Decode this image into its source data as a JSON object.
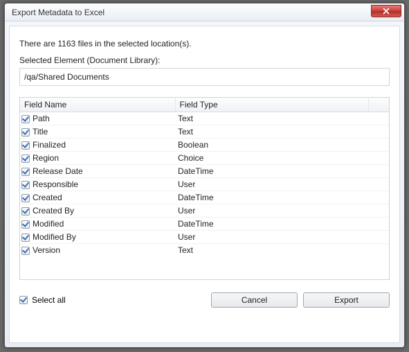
{
  "window": {
    "title": "Export Metadata to Excel"
  },
  "info": {
    "file_count_line": "There are 1163 files in the selected location(s)."
  },
  "selected_element": {
    "label": "Selected Element (Document Library):",
    "path": "/qa/Shared Documents"
  },
  "table": {
    "headers": {
      "name": "Field Name",
      "type": "Field Type"
    },
    "rows": [
      {
        "checked": true,
        "name": "Path",
        "type": "Text"
      },
      {
        "checked": true,
        "name": "Title",
        "type": "Text"
      },
      {
        "checked": true,
        "name": "Finalized",
        "type": "Boolean"
      },
      {
        "checked": true,
        "name": "Region",
        "type": "Choice"
      },
      {
        "checked": true,
        "name": "Release Date",
        "type": "DateTime"
      },
      {
        "checked": true,
        "name": "Responsible",
        "type": "User"
      },
      {
        "checked": true,
        "name": "Created",
        "type": "DateTime"
      },
      {
        "checked": true,
        "name": "Created By",
        "type": "User"
      },
      {
        "checked": true,
        "name": "Modified",
        "type": "DateTime"
      },
      {
        "checked": true,
        "name": "Modified By",
        "type": "User"
      },
      {
        "checked": true,
        "name": "Version",
        "type": "Text"
      }
    ]
  },
  "footer": {
    "select_all": {
      "checked": true,
      "label": "Select all"
    },
    "cancel": "Cancel",
    "export": "Export"
  }
}
